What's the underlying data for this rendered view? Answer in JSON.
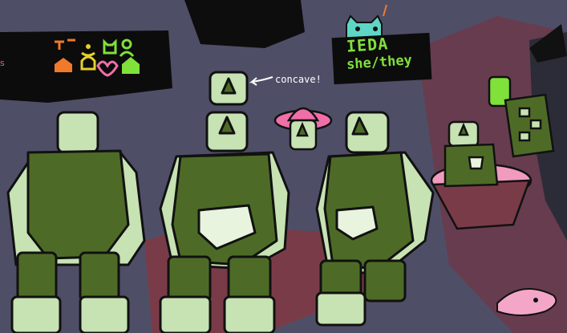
{
  "character": {
    "name": "IEDA",
    "pronouns": "she/they"
  },
  "annotation": {
    "text": "concave!"
  },
  "left_edge_text": "s",
  "palette": {
    "background": "#4f4e67",
    "body_dark": "#4d6b26",
    "body_light": "#c7e2b3",
    "accent_green": "#7fe13a",
    "accent_pink": "#f06fa8",
    "accent_orange": "#f07a2a"
  },
  "icons": [
    "pronoun-icon-orange",
    "face-icon-yellow",
    "cat-icon-green",
    "people-icon-green",
    "house-icon-orange",
    "bell-icon-yellow",
    "heart-icon-pink",
    "house-icon-green"
  ]
}
